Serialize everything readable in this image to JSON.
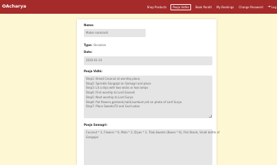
{
  "brand": "OAcharya",
  "nav": {
    "links": [
      "Shop Products",
      "Pooja Vidhis",
      "Book Pandit",
      "My Bookings",
      "Change Password",
      "Log"
    ],
    "active_index": 1
  },
  "form": {
    "name_label": "Name:",
    "name_value": "Makar sankranti",
    "type_label": "Type:",
    "type_value": "Occasion",
    "date_label": "Date:",
    "date_value": "2020-01-14",
    "vidhi_label": "Pooja Vidhi:",
    "vidhi_lines": [
      "Step1: Bread Coconut at worship place,",
      "Step2: Sprinkle Gangajal on Samagri and place",
      "Step3: Lit a diya with two wicks or two lamps",
      "Step4: First worship to Lord Ganesh",
      "Step5: Next worship to Lord Surya",
      "Step6: Put flowers,garlands,haldi,kumkum,roli on photo of Lord Surya",
      "Step7: Place Sweets(Til and Gud Ladoo"
    ],
    "samagri_label": "Pooja Samagri:",
    "samagri_lines": [
      "Coconut * 2, Flowers * 6, Mats * 2, Diyas * 3, Tilak,Sweets (Boxes * 6), Flat Stools, Small bottle of",
      "Gangajal"
    ]
  },
  "colors": {
    "navbar": "#a52a2a",
    "background": "#fdf7d4",
    "field": "#e5e5e5"
  }
}
